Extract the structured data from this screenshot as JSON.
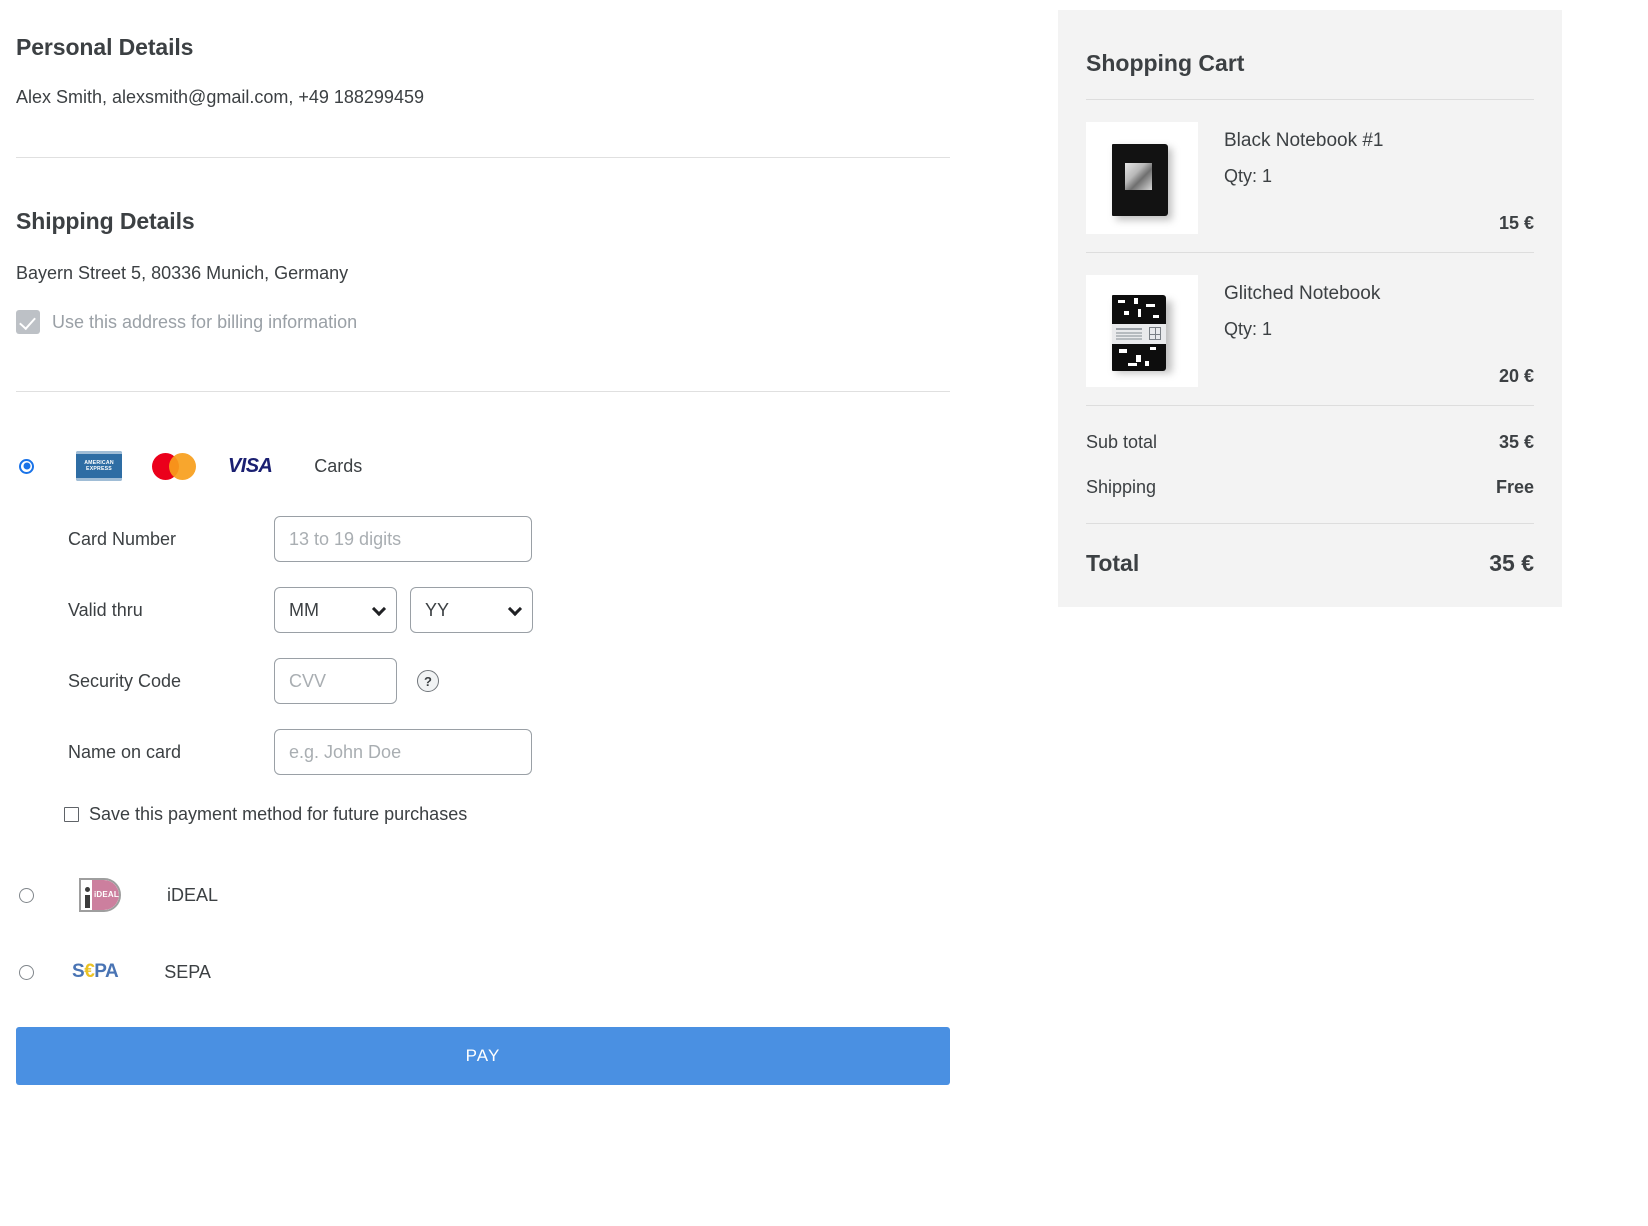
{
  "personal": {
    "title": "Personal Details",
    "summary": "Alex Smith, alexsmith@gmail.com, +49 188299459"
  },
  "shipping": {
    "title": "Shipping Details",
    "address": "Bayern Street 5, 80336 Munich, Germany",
    "billing_checkbox_label": "Use this address for billing information"
  },
  "payment": {
    "methods": [
      {
        "id": "cards",
        "label": "Cards",
        "selected": true
      },
      {
        "id": "ideal",
        "label": "iDEAL",
        "selected": false
      },
      {
        "id": "sepa",
        "label": "SEPA",
        "selected": false
      }
    ],
    "brands": {
      "amex": "AMERICAN EXPRESS",
      "visa": "VISA",
      "ideal": "iDEAL",
      "sepa_s": "S",
      "sepa_eu": "€",
      "sepa_pa": "PA"
    },
    "card_form": {
      "card_number_label": "Card Number",
      "card_number_placeholder": "13 to 19 digits",
      "valid_thru_label": "Valid thru",
      "month_placeholder": "MM",
      "year_placeholder": "YY",
      "security_code_label": "Security Code",
      "security_code_placeholder": "CVV",
      "help_glyph": "?",
      "name_on_card_label": "Name on card",
      "name_on_card_placeholder": "e.g. John Doe",
      "save_method_label": "Save this payment method for future purchases"
    },
    "pay_button": "PAY"
  },
  "cart": {
    "title": "Shopping Cart",
    "items": [
      {
        "name": "Black Notebook #1",
        "qty": "Qty: 1",
        "price": "15 €"
      },
      {
        "name": "Glitched Notebook",
        "qty": "Qty: 1",
        "price": "20 €"
      }
    ],
    "subtotal_label": "Sub total",
    "subtotal_value": "35 €",
    "shipping_label": "Shipping",
    "shipping_value": "Free",
    "total_label": "Total",
    "total_value": "35 €"
  },
  "colors": {
    "accent": "#4a90e2",
    "radio_selected": "#1a73e8",
    "panel_bg": "#f3f3f3",
    "amex_blue": "#2e6da4",
    "mastercard_red": "#eb001b",
    "mastercard_orange": "#f79e1b",
    "visa_navy": "#1a1f71",
    "ideal_pink": "#cc7f9e",
    "sepa_blue": "#2a5ca8",
    "sepa_yellow": "#e8b800"
  }
}
